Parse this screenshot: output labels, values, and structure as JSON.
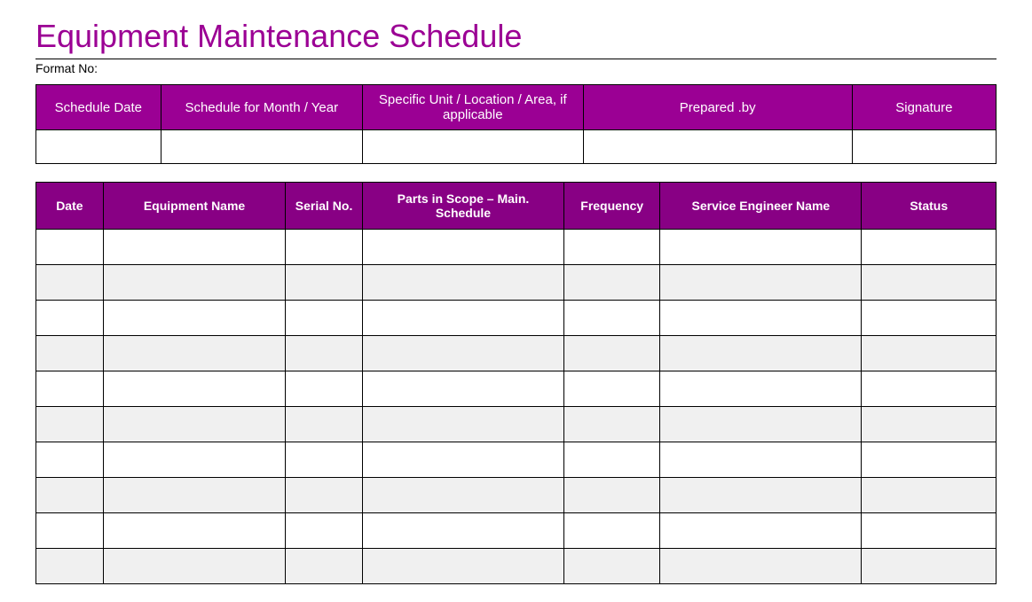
{
  "title": "Equipment Maintenance Schedule",
  "format_label": "Format No:",
  "meta_headers": {
    "schedule_date": "Schedule Date",
    "schedule_for": "Schedule for Month / Year",
    "unit_location": "Specific Unit / Location  / Area, if applicable",
    "prepared_by": "Prepared .by",
    "signature": "Signature"
  },
  "meta_row": {
    "schedule_date": "",
    "schedule_for": "",
    "unit_location": "",
    "prepared_by": "",
    "signature": ""
  },
  "data_headers": {
    "date": "Date",
    "equipment_name": "Equipment Name",
    "serial_no": "Serial No.",
    "parts_scope": "Parts in Scope – Main. Schedule",
    "frequency": "Frequency",
    "engineer": "Service Engineer Name",
    "status": "Status"
  },
  "rows": [
    {
      "date": "",
      "equipment_name": "",
      "serial_no": "",
      "parts_scope": "",
      "frequency": "",
      "engineer": "",
      "status": ""
    },
    {
      "date": "",
      "equipment_name": "",
      "serial_no": "",
      "parts_scope": "",
      "frequency": "",
      "engineer": "",
      "status": ""
    },
    {
      "date": "",
      "equipment_name": "",
      "serial_no": "",
      "parts_scope": "",
      "frequency": "",
      "engineer": "",
      "status": ""
    },
    {
      "date": "",
      "equipment_name": "",
      "serial_no": "",
      "parts_scope": "",
      "frequency": "",
      "engineer": "",
      "status": ""
    },
    {
      "date": "",
      "equipment_name": "",
      "serial_no": "",
      "parts_scope": "",
      "frequency": "",
      "engineer": "",
      "status": ""
    },
    {
      "date": "",
      "equipment_name": "",
      "serial_no": "",
      "parts_scope": "",
      "frequency": "",
      "engineer": "",
      "status": ""
    },
    {
      "date": "",
      "equipment_name": "",
      "serial_no": "",
      "parts_scope": "",
      "frequency": "",
      "engineer": "",
      "status": ""
    },
    {
      "date": "",
      "equipment_name": "",
      "serial_no": "",
      "parts_scope": "",
      "frequency": "",
      "engineer": "",
      "status": ""
    },
    {
      "date": "",
      "equipment_name": "",
      "serial_no": "",
      "parts_scope": "",
      "frequency": "",
      "engineer": "",
      "status": ""
    },
    {
      "date": "",
      "equipment_name": "",
      "serial_no": "",
      "parts_scope": "",
      "frequency": "",
      "engineer": "",
      "status": ""
    }
  ]
}
